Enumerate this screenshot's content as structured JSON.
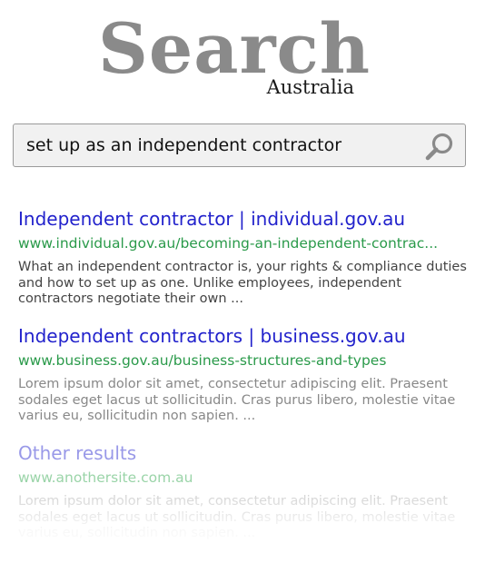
{
  "logo": {
    "title": "Search",
    "subtitle": "Australia"
  },
  "search": {
    "query": "set up as an independent contractor",
    "icon": "magnifier-icon"
  },
  "results": [
    {
      "title": "Independent contractor | individual.gov.au",
      "url": "www.individual.gov.au/becoming-an-independent-contrac...",
      "snippet": "What an independent contractor is, your rights & compliance duties and how to set up as one. Unlike employees, independent contractors negotiate their own ..."
    },
    {
      "title": "Independent contractors | business.gov.au",
      "url": "www.business.gov.au/business-structures-and-types",
      "snippet": "Lorem ipsum dolor sit amet, consectetur adipiscing elit. Praesent sodales eget lacus ut sollicitudin. Cras purus libero, molestie vitae varius eu, sollicitudin non sapien. ..."
    },
    {
      "title": "Other results",
      "url": "www.anothersite.com.au",
      "snippet": "Lorem ipsum dolor sit amet, consectetur adipiscing elit. Praesent sodales eget lacus ut sollicitudin. Cras purus libero, molestie vitae varius eu, sollicitudin non sapien. ..."
    }
  ],
  "colors": {
    "logo_gray": "#8a8a8a",
    "link_blue": "#2222cc",
    "url_green": "#2a9a4a",
    "snippet_gray": "#444444"
  }
}
